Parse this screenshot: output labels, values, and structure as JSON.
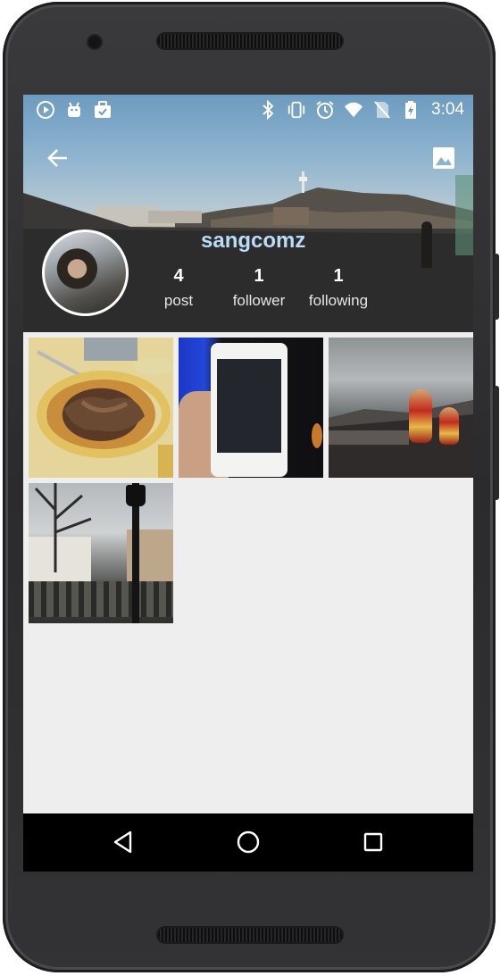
{
  "status_bar": {
    "time": "3:04",
    "left_icons": [
      "play-circle-icon",
      "android-icon",
      "briefcase-icon"
    ],
    "right_icons": [
      "bluetooth-icon",
      "vibrate-icon",
      "alarm-icon",
      "wifi-icon",
      "no-sim-icon",
      "battery-icon"
    ]
  },
  "toolbar": {
    "back_icon": "arrow-back-icon",
    "action_icon": "image-icon"
  },
  "profile": {
    "username": "sangcomz",
    "stats": [
      {
        "value": "4",
        "label": "post"
      },
      {
        "value": "1",
        "label": "follower"
      },
      {
        "value": "1",
        "label": "following"
      }
    ]
  },
  "photos": [
    {
      "subject": "grilled-meat-photo"
    },
    {
      "subject": "smartphone-photo"
    },
    {
      "subject": "matryoshka-dolls-photo"
    },
    {
      "subject": "street-lamp-photo"
    }
  ],
  "navigation_bar": {
    "icons": [
      "back-triangle-icon",
      "home-circle-icon",
      "recents-square-icon"
    ]
  },
  "colors": {
    "username": "#b9dcf7",
    "screen_background": "#eeeeee",
    "nav_background": "#000000",
    "phone_body": "#2f2f31"
  }
}
